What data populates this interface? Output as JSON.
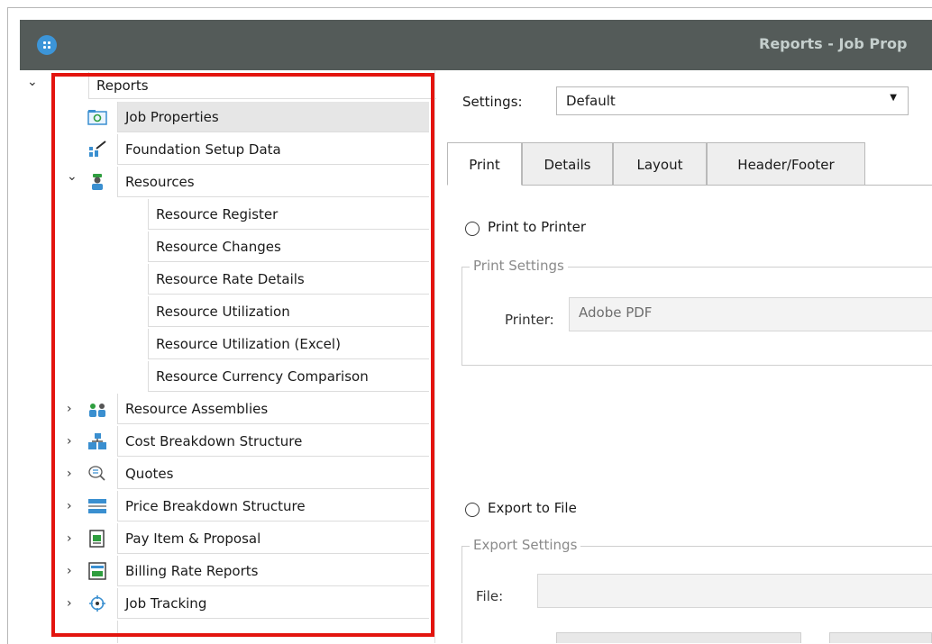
{
  "window": {
    "title": "Reports - Job Prop",
    "app_icon": "app-logo-icon"
  },
  "tree": {
    "root": {
      "label": "Reports",
      "expanded": true
    },
    "items": [
      {
        "label": "Job Properties",
        "icon": "job-properties-icon",
        "selected": true
      },
      {
        "label": "Foundation Setup Data",
        "icon": "foundation-setup-icon"
      },
      {
        "label": "Resources",
        "icon": "resources-icon",
        "expanded": true,
        "children": [
          {
            "label": "Resource Register"
          },
          {
            "label": "Resource Changes"
          },
          {
            "label": "Resource Rate Details"
          },
          {
            "label": "Resource Utilization"
          },
          {
            "label": "Resource Utilization (Excel)"
          },
          {
            "label": "Resource Currency Comparison"
          }
        ]
      },
      {
        "label": "Resource Assemblies",
        "icon": "resource-assemblies-icon",
        "expanded": false
      },
      {
        "label": "Cost Breakdown Structure",
        "icon": "cost-breakdown-icon",
        "expanded": false
      },
      {
        "label": "Quotes",
        "icon": "quotes-icon",
        "expanded": false
      },
      {
        "label": "Price Breakdown Structure",
        "icon": "price-breakdown-icon",
        "expanded": false
      },
      {
        "label": "Pay Item & Proposal",
        "icon": "pay-item-icon",
        "expanded": false
      },
      {
        "label": "Billing Rate Reports",
        "icon": "billing-rate-icon",
        "expanded": false
      },
      {
        "label": "Job Tracking",
        "icon": "job-tracking-icon",
        "expanded": false
      }
    ]
  },
  "settings": {
    "label": "Settings:",
    "value": "Default"
  },
  "tabs": [
    {
      "label": "Print",
      "active": true
    },
    {
      "label": "Details"
    },
    {
      "label": "Layout"
    },
    {
      "label": "Header/Footer"
    }
  ],
  "print": {
    "option_label": "Print to Printer",
    "group_title": "Print Settings",
    "printer_label": "Printer:",
    "printer_value": "Adobe PDF"
  },
  "export": {
    "option_label": "Export to File",
    "group_title": "Export Settings",
    "file_label": "File:",
    "file_value": ""
  },
  "colors": {
    "highlight_border": "#e3140e",
    "titlebar": "#545b59",
    "selected_row": "#e6e6e6"
  }
}
